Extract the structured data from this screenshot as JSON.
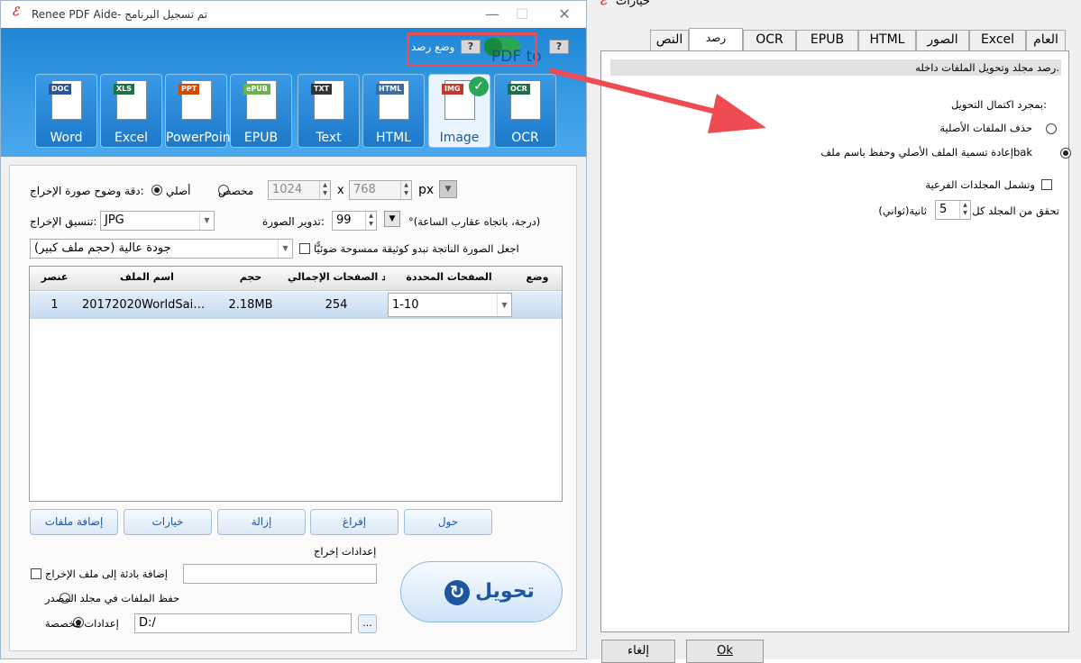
{
  "main_window": {
    "title": "Renee PDF Aide- تم تسجيل البرنامج",
    "app_icon": "ℰ",
    "min_glyph": "—",
    "max_glyph": "☐",
    "close_glyph": "✕",
    "mode_label": "وضع رصد",
    "help_glyph": "?",
    "pdf_to": "PDF to",
    "formats": [
      {
        "tag": "DOC",
        "label": "Word",
        "tag_color": "#2b5797"
      },
      {
        "tag": "XLS",
        "label": "Excel",
        "tag_color": "#1e7145"
      },
      {
        "tag": "PPT",
        "label": "PowerPoint",
        "tag_color": "#d04a02"
      },
      {
        "tag": "ePUB",
        "label": "EPUB",
        "tag_color": "#6ab04c"
      },
      {
        "tag": "TXT",
        "label": "Text",
        "tag_color": "#333333"
      },
      {
        "tag": "HTML",
        "label": "HTML",
        "tag_color": "#3c6ea0"
      },
      {
        "tag": "IMG",
        "label": "Image",
        "tag_color": "#c0392b",
        "selected": true
      },
      {
        "tag": "OCR",
        "label": "OCR",
        "tag_color": "#1e7145"
      }
    ],
    "resolution_label": "دقة وضوح صورة الإخراج:",
    "original_label": "أصلي",
    "custom_label": "مخصص",
    "width_value": "1024",
    "x_sep": "x",
    "height_value": "768",
    "px_label": "px",
    "format_label": "تنسيق الإخراج:",
    "format_value": "JPG",
    "rotate_label": "تدوير الصورة:",
    "rotate_value": "99",
    "rotate_unit": "°(درجة، باتجاه عقارب الساعة)",
    "quality_value": "(جودة عالية (حجم ملف كبير",
    "scan_label": "اجعل الصورة الناتجة تبدو كوثيقة ممسوحة ضوئيًّا",
    "table_headers": [
      "عنصر",
      "اسم الملف",
      "حجم",
      "عدد الصفحات الإجمالي",
      "الصفحات المحددة",
      "وضع"
    ],
    "rows": [
      {
        "index": "1",
        "name": "20172020WorldSai…",
        "size": "2.18MB",
        "pages": "254",
        "selected_pages": "1-10"
      }
    ],
    "buttons": {
      "add": "إضافة ملفات",
      "options": "خيارات",
      "remove": "إزالة",
      "clear": "إفراغ",
      "about": "حول"
    },
    "output_settings_label": "إعدادات إخراج",
    "prefix_label": "إضافة بادئة إلى ملف الإخراج",
    "prefix_value": "",
    "save_source_label": "حفظ الملفات في مجلد المصدر",
    "custom_settings_label": "إعدادات مخصصة",
    "path_value": "D:/",
    "browse_label": "...",
    "convert_label": "تحويل"
  },
  "options_window": {
    "title": "خيارات",
    "app_icon": "ℰ",
    "tabs": [
      "العام",
      "Excel",
      "الصور",
      "HTML",
      "EPUB",
      "OCR",
      "رصد",
      "النص"
    ],
    "active_tab": "رصد",
    "description": "رصد مجلد وتحويل الملفات داخله.",
    "after_label": "بمجرد اكتمال التحويل:",
    "delete_label": "حذف الملفات الأصلية",
    "rename_label": "إعادة تسمية الملف الأصلي وحفظ باسم ملفbak",
    "subfolders_label": "وتشمل المجلدات الفرعية",
    "check_label": "تحقق من المجلد كل",
    "check_value": "5",
    "check_unit": "ثانية(ثواني)",
    "cancel_label": "إلغاء",
    "ok_label": "Ok"
  },
  "colors": {
    "banner": "#2b8fdf",
    "highlight": "#ee4b53",
    "accent": "#1f56a0"
  }
}
